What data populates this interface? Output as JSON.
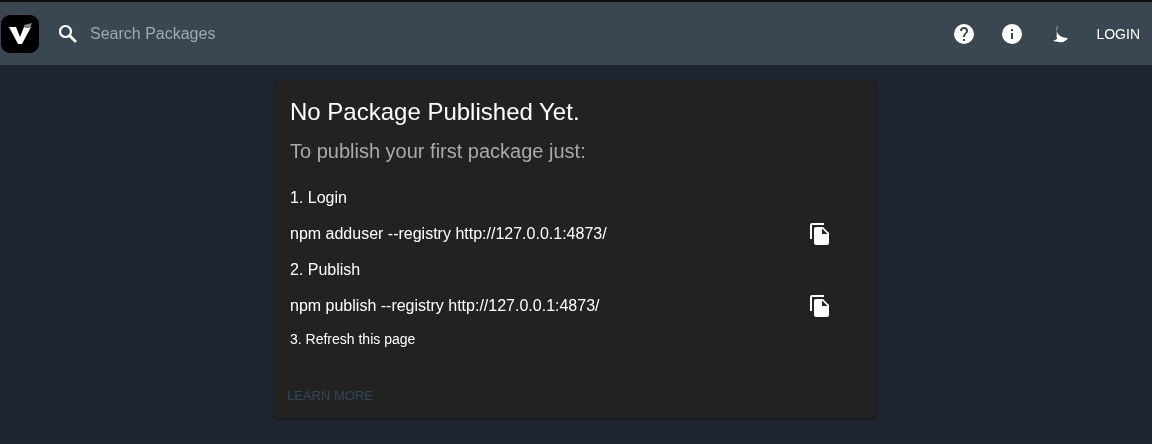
{
  "header": {
    "search": {
      "placeholder": "Search Packages"
    },
    "login": "LOGIN"
  },
  "card": {
    "title": "No Package Published Yet.",
    "subtitle": "To publish your first package just:",
    "steps": [
      {
        "kind": "step",
        "text": "1. Login"
      },
      {
        "kind": "command",
        "text": "npm adduser --registry http://127.0.0.1:4873/"
      },
      {
        "kind": "step",
        "text": "2. Publish"
      },
      {
        "kind": "command",
        "text": "npm publish --registry http://127.0.0.1:4873/"
      },
      {
        "kind": "note",
        "text": "3. Refresh this page"
      }
    ],
    "link": "LEARN MORE"
  }
}
